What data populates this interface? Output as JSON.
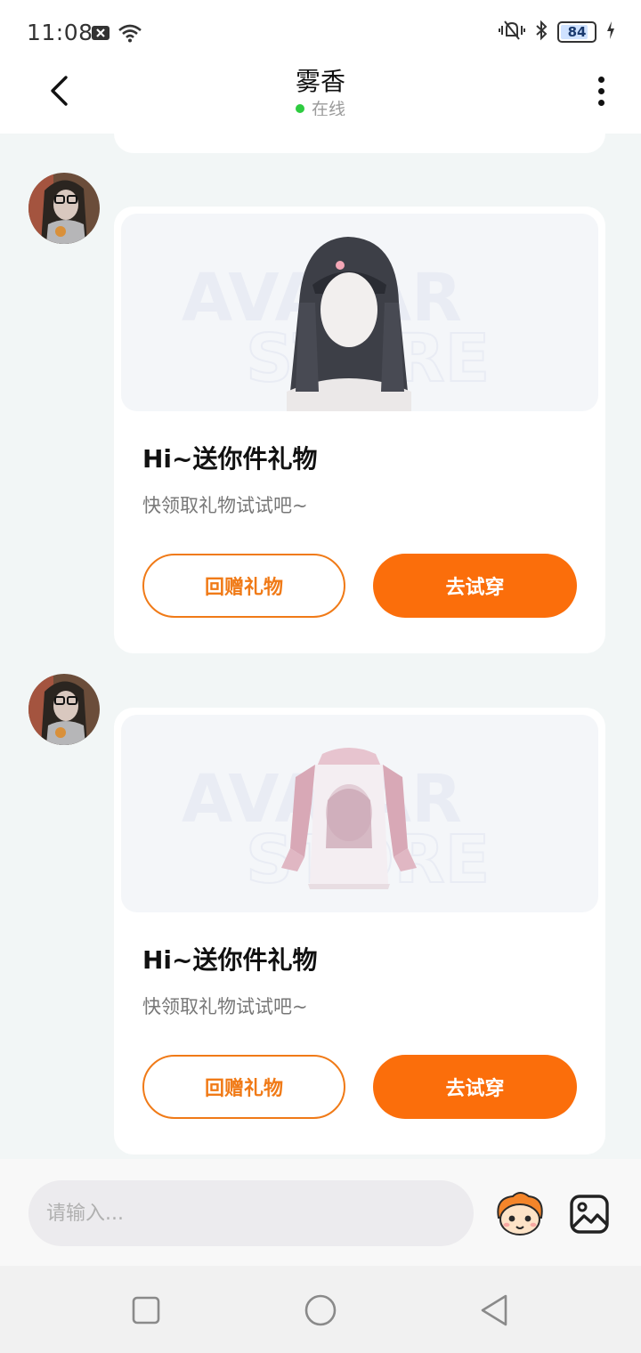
{
  "status_bar": {
    "time": "11:08",
    "battery_level": "84",
    "battery_fraction": 0.84
  },
  "header": {
    "title": "雾香",
    "status": "在线",
    "status_color": "#2ecc40"
  },
  "messages": [
    {
      "title": "Hi~送你件礼物",
      "subtitle": "快领取礼物试试吧~",
      "gift_image": "hairstyle-gift-image",
      "button_return": "回赠礼物",
      "button_try": "去试穿"
    },
    {
      "title": "Hi~送你件礼物",
      "subtitle": "快领取礼物试试吧~",
      "gift_image": "hoodie-gift-image",
      "button_return": "回赠礼物",
      "button_try": "去试穿"
    }
  ],
  "input": {
    "placeholder": "请输入..."
  },
  "icons": {
    "back": "back-arrow-icon",
    "more": "more-vertical-icon",
    "emoji": "emoji-mascot-icon",
    "image": "image-picker-icon",
    "nav_recent": "recent-apps-icon",
    "nav_home": "home-icon",
    "nav_back": "nav-back-icon"
  },
  "colors": {
    "accent": "#fb6e0b",
    "accent_border": "#f07a17",
    "background": "#f2f6f6"
  }
}
